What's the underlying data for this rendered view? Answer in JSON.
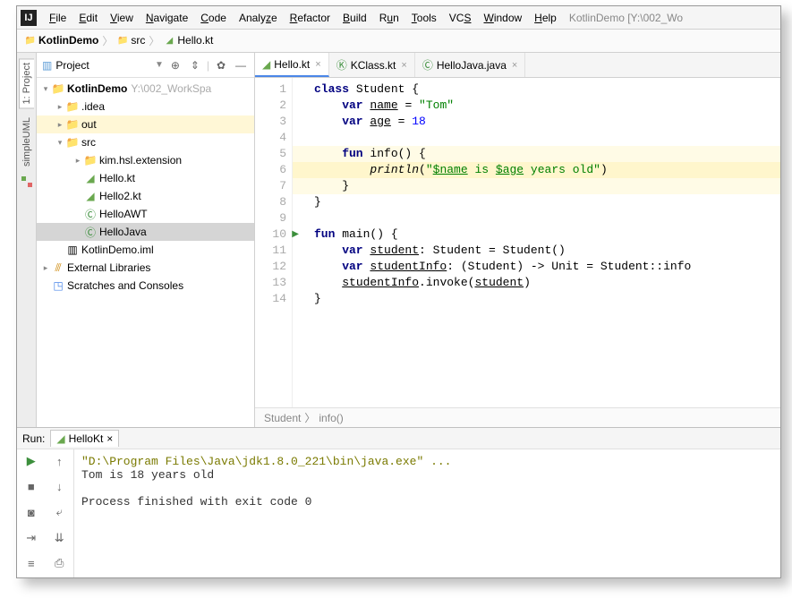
{
  "title_path": "KotlinDemo [Y:\\002_Wo",
  "menu": [
    "File",
    "Edit",
    "View",
    "Navigate",
    "Code",
    "Analyze",
    "Refactor",
    "Build",
    "Run",
    "Tools",
    "VCS",
    "Window",
    "Help"
  ],
  "breadcrumb": {
    "project": "KotlinDemo",
    "folder": "src",
    "file": "Hello.kt"
  },
  "side_tabs": {
    "project": "1: Project",
    "uml": "simpleUML"
  },
  "project_header": {
    "title": "Project"
  },
  "tree": {
    "root": "KotlinDemo",
    "root_hint": "Y:\\002_WorkSpa",
    "idea": ".idea",
    "out": "out",
    "src": "src",
    "ext": "kim.hsl.extension",
    "f1": "Hello.kt",
    "f2": "Hello2.kt",
    "f3": "HelloAWT",
    "f4": "HelloJava",
    "iml": "KotlinDemo.iml",
    "libs": "External Libraries",
    "scratch": "Scratches and Consoles"
  },
  "editor_tabs": [
    {
      "name": "Hello.kt",
      "active": true,
      "icon": "kt"
    },
    {
      "name": "KClass.kt",
      "active": false,
      "icon": "kt"
    },
    {
      "name": "HelloJava.java",
      "active": false,
      "icon": "java"
    }
  ],
  "gutter_lines": [
    "1",
    "2",
    "3",
    "4",
    "5",
    "6",
    "7",
    "8",
    "9",
    "10",
    "11",
    "12",
    "13",
    "14"
  ],
  "code": {
    "l1a": "class",
    "l1b": " Student {",
    "l2a": "    var ",
    "l2n": "name",
    "l2b": " = ",
    "l2s": "\"Tom\"",
    "l3a": "    var ",
    "l3n": "age",
    "l3b": " = ",
    "l3v": "18",
    "l5a": "    fun",
    "l5b": " info() {",
    "l6a": "        ",
    "l6f": "println",
    "l6p": "(",
    "l6s1": "\"",
    "l6v1": "$name",
    "l6s2": " is ",
    "l6v2": "$age",
    "l6s3": " years old\"",
    "l6c": ")",
    "l7": "    }",
    "l8": "}",
    "l10a": "fun",
    "l10b": " main() {",
    "l11a": "    var ",
    "l11n": "student",
    "l11b": ": Student = Student()",
    "l12a": "    var ",
    "l12n": "studentInfo",
    "l12b": ": (Student) -> Unit = Student::info",
    "l13a": "    ",
    "l13n": "studentInfo",
    "l13b": ".invoke(",
    "l13c": "student",
    "l13d": ")",
    "l14": "}"
  },
  "editor_crumb": {
    "a": "Student",
    "b": "info()"
  },
  "run": {
    "label": "Run:",
    "tab": "HelloKt",
    "line1": "\"D:\\Program Files\\Java\\jdk1.8.0_221\\bin\\java.exe\" ...",
    "line2": "Tom is 18 years old",
    "line3": "Process finished with exit code 0"
  }
}
